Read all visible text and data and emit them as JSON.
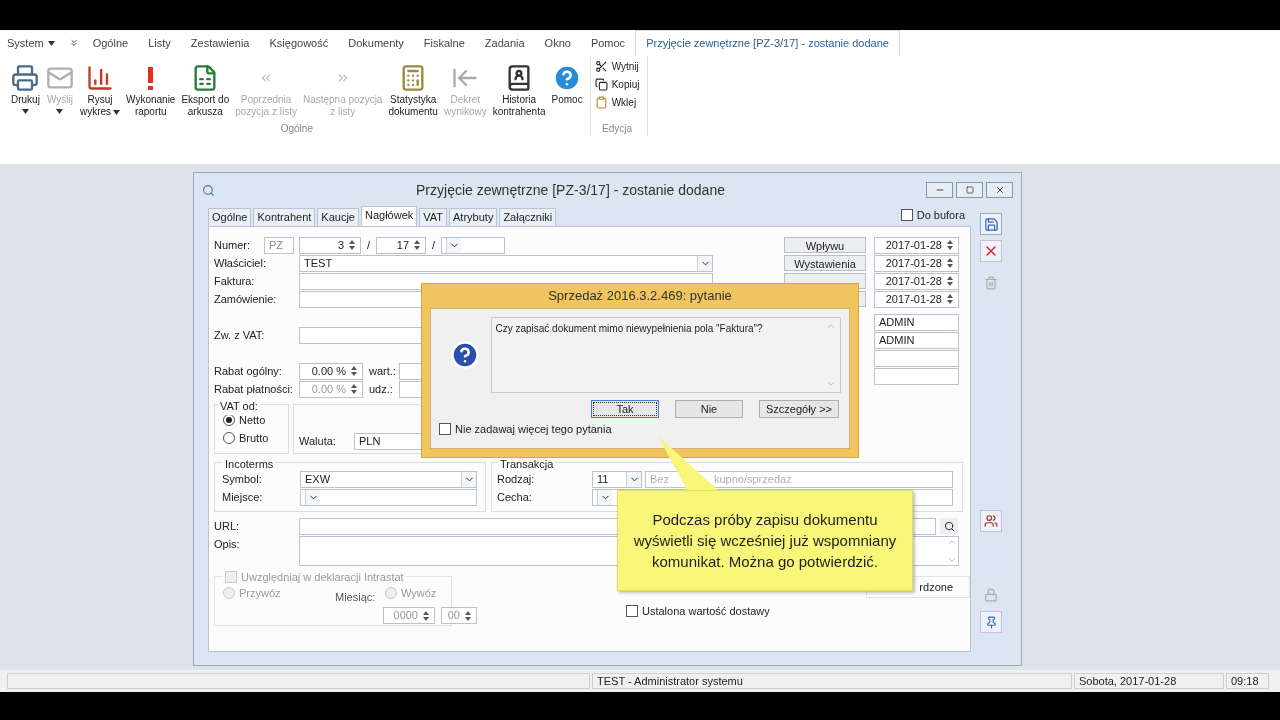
{
  "menu_bar": {
    "items": [
      {
        "label": "System",
        "dropdown": true,
        "selected": false
      },
      {
        "label": "Ogólne",
        "dropdown": false,
        "selected": false
      },
      {
        "label": "Listy",
        "dropdown": false,
        "selected": false
      },
      {
        "label": "Zestawienia",
        "dropdown": false,
        "selected": false
      },
      {
        "label": "Księgowość",
        "dropdown": false,
        "selected": false
      },
      {
        "label": "Dokumenty",
        "dropdown": false,
        "selected": false
      },
      {
        "label": "Fiskalne",
        "dropdown": false,
        "selected": false
      },
      {
        "label": "Zadania",
        "dropdown": false,
        "selected": false
      },
      {
        "label": "Okno",
        "dropdown": false,
        "selected": false
      },
      {
        "label": "Pomoc",
        "dropdown": false,
        "selected": false
      },
      {
        "label": "Przyjęcie zewnętrzne [PZ-3/17]  - zostanie dodane",
        "dropdown": false,
        "selected": true
      }
    ]
  },
  "ribbon": {
    "groups": [
      {
        "label": "Ogólne",
        "kind": "large",
        "buttons": [
          {
            "lines": [
              "Drukuj"
            ],
            "disabled": false,
            "dropdown": true
          },
          {
            "lines": [
              "Wyślij"
            ],
            "disabled": true,
            "dropdown": true
          },
          {
            "lines": [
              "Rysuj",
              "wykres"
            ],
            "disabled": false,
            "dropdown": true
          },
          {
            "lines": [
              "Wykonanie",
              "raportu"
            ],
            "disabled": false,
            "dropdown": false
          },
          {
            "lines": [
              "Eksport do",
              "arkusza"
            ],
            "disabled": false,
            "dropdown": false
          },
          {
            "lines": [
              "Poprzednia",
              "pozycja z listy"
            ],
            "disabled": true,
            "dropdown": false
          },
          {
            "lines": [
              "Następna pozycja",
              "z listy"
            ],
            "disabled": true,
            "dropdown": false
          },
          {
            "lines": [
              "Statystyka",
              "dokumentu"
            ],
            "disabled": false,
            "dropdown": false
          },
          {
            "lines": [
              "Dekret",
              "wynikowy"
            ],
            "disabled": true,
            "dropdown": false
          },
          {
            "lines": [
              "Historia",
              "kontrahenta"
            ],
            "disabled": false,
            "dropdown": false
          },
          {
            "lines": [
              "Pomoc"
            ],
            "disabled": false,
            "dropdown": false
          }
        ]
      },
      {
        "label": "Edycja",
        "kind": "small",
        "buttons": [
          {
            "lines": [
              "Wytnij"
            ],
            "disabled": false
          },
          {
            "lines": [
              "Kopiuj"
            ],
            "disabled": false
          },
          {
            "lines": [
              "Wklej"
            ],
            "disabled": false
          }
        ]
      }
    ]
  },
  "window": {
    "title": "Przyjęcie zewnętrzne [PZ-3/17]  - zostanie dodane",
    "tabs": [
      {
        "label": "Ogólne",
        "selected": false
      },
      {
        "label": "Kontrahent",
        "selected": false
      },
      {
        "label": "Kaucje",
        "selected": false
      },
      {
        "label": "Nagłówek",
        "selected": true
      },
      {
        "label": "VAT",
        "selected": false
      },
      {
        "label": "Atrybuty",
        "selected": false
      },
      {
        "label": "Załączniki",
        "selected": false
      }
    ],
    "to_buffer": {
      "label": "Do bufora",
      "checked": false
    }
  },
  "form": {
    "number": {
      "label": "Numer:",
      "prefix": "PZ",
      "value": "3",
      "separator_1": "/",
      "year": "17",
      "separator_2": "/"
    },
    "owner": {
      "label": "Właściciel:",
      "value": "TEST"
    },
    "invoice": {
      "label": "Faktura:"
    },
    "order": {
      "label": "Zamówienie:"
    },
    "vat_exempt": {
      "label": "Zw. z VAT:"
    },
    "discount": {
      "label": "Rabat ogólny:",
      "value": "0.00 %",
      "disabled": false,
      "side_label": "wart.:"
    },
    "payment_discount": {
      "label": "Rabat płatności:",
      "value": "0.00 %",
      "disabled": true,
      "side_label": "udz.:"
    },
    "vat_from": {
      "label": "VAT od:",
      "options": [
        {
          "label": "Netto",
          "selected": true
        },
        {
          "label": "Brutto",
          "selected": false
        }
      ]
    },
    "currency": {
      "label": "Waluta:",
      "value": "PLN"
    },
    "dates": [
      {
        "button": "Wpływu",
        "value": "2017-01-28"
      },
      {
        "button": "Wystawienia",
        "value": "2017-01-28"
      },
      {
        "value": "2017-01-28"
      },
      {
        "value": "2017-01-28"
      }
    ],
    "users": [
      "ADMIN",
      "ADMIN"
    ],
    "incoterms": {
      "label": "Incoterms",
      "symbol_label": "Symbol:",
      "symbol": "EXW",
      "place_label": "Miejsce:"
    },
    "transaction": {
      "label": "Transakcja",
      "kind_label": "Rodzaj:",
      "kind": "11",
      "kind_hint_start": "Bez",
      "kind_hint_end": "kupno/sprzedaż",
      "feature_label": "Cecha:"
    },
    "url": {
      "label": "URL:"
    },
    "description": {
      "label": "Opis:"
    },
    "intrastat": {
      "label": "Uwzględniaj w deklaracji Intrastat",
      "checked": false,
      "import": {
        "label": "Przywóz",
        "selected": false
      },
      "export": {
        "label": "Wywóz",
        "selected": false
      },
      "month_label": "Miesiąc:",
      "year": "0000",
      "month": "00"
    },
    "confirmed_fragment": "rdzone",
    "fixed_value": {
      "label": "Ustalona wartość dostawy",
      "checked": false
    }
  },
  "dialog": {
    "title": "Sprzedaż 2016.3.2.469: pytanie",
    "message": "Czy zapisać dokument mimo niewypełnienia pola \"Faktura\"?",
    "buttons": [
      {
        "label": "Tak",
        "selected": true
      },
      {
        "label": "Nie",
        "selected": false
      },
      {
        "label": "Szczegóły >>",
        "selected": false
      }
    ],
    "dont_ask": {
      "label": "Nie zadawaj więcej tego pytania",
      "checked": false
    }
  },
  "callout": {
    "text": "Podczas próby zapisu dokumentu wyświetli się wcześniej już wspomniany komunikat. Można go potwierdzić."
  },
  "status_bar": {
    "user": "TEST - Administrator systemu",
    "date": "Sobota, 2017-01-28",
    "time": "09:18"
  }
}
